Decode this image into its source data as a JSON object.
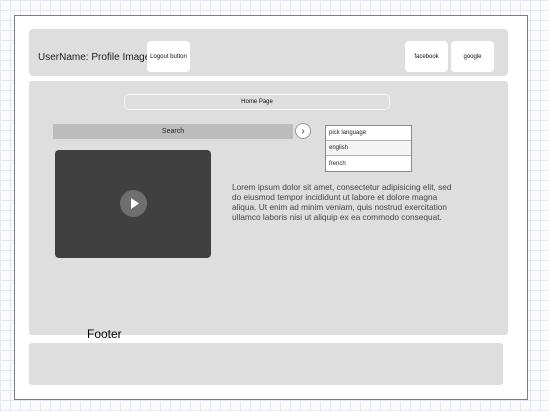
{
  "header": {
    "user_label": "UserName: Profile Image:",
    "logout_label": "Logout button",
    "facebook_label": "facebook",
    "google_label": "google"
  },
  "main": {
    "home_label": "Home Page",
    "search_label": "Search",
    "go_icon": "chevron-right-icon",
    "language": {
      "selected": "pick language",
      "options": [
        "english",
        "french"
      ]
    },
    "video": {
      "icon": "play-icon"
    },
    "body_text": "Lorem ipsum dolor sit amet, consectetur adipisicing elit, sed do eiusmod tempor incididunt ut labore et dolore magna aliqua. Ut enim ad minim veniam, quis nostrud exercitation ullamco laboris nisi ut aliquip ex ea commodo consequat."
  },
  "footer": {
    "label": "Footer"
  }
}
